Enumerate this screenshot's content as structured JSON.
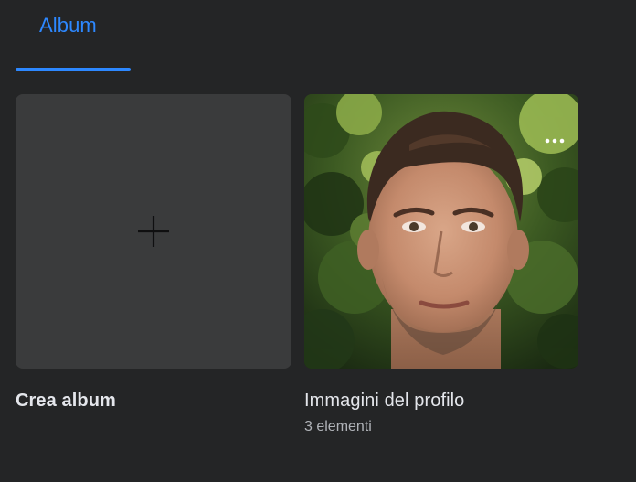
{
  "tabs": {
    "active_label": "Album"
  },
  "albums": {
    "create": {
      "label": "Crea album"
    },
    "profile": {
      "label": "Immagini del profilo",
      "count_text": "3 elementi"
    }
  },
  "colors": {
    "accent": "#2d88ff",
    "background": "#242526",
    "card_bg": "#3a3b3c",
    "text_primary": "#e4e6eb",
    "text_secondary": "#b0b3b8"
  },
  "icons": {
    "plus": "plus-icon",
    "more": "more-horizontal-icon"
  }
}
